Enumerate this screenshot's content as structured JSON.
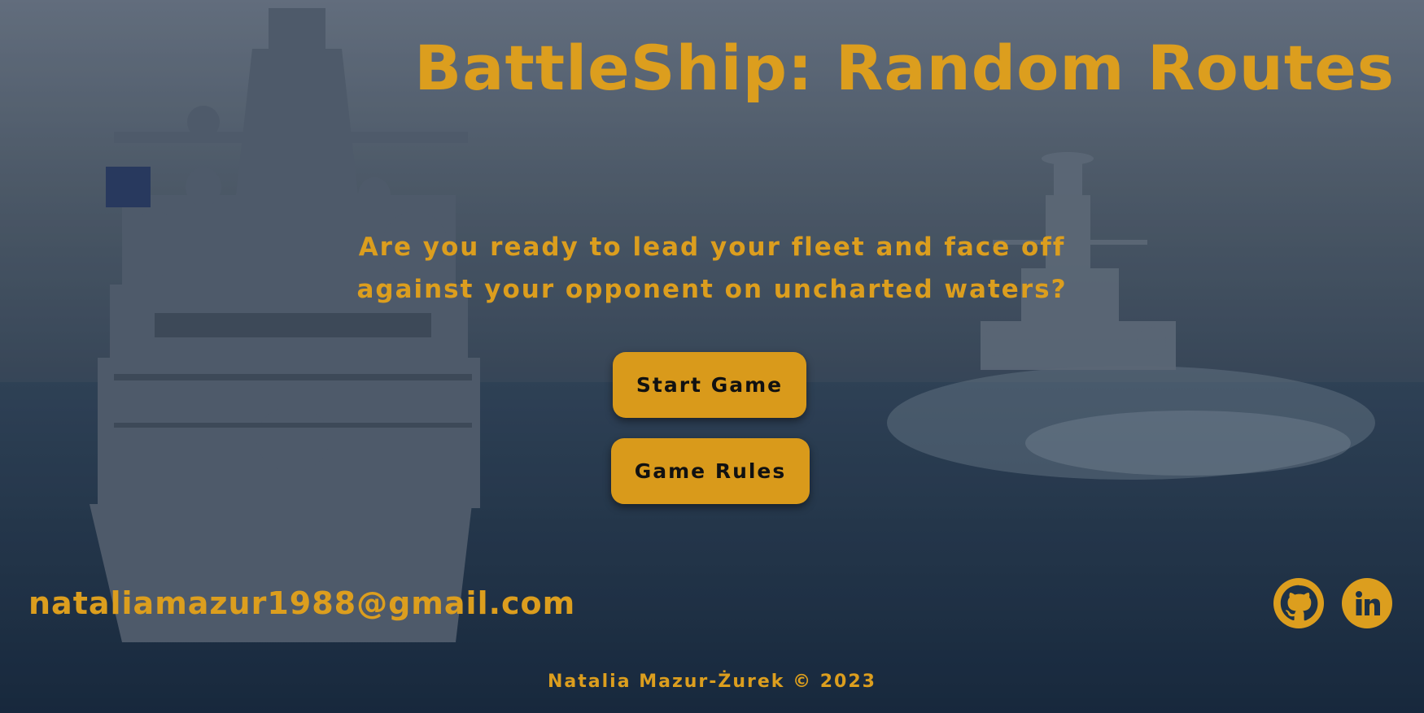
{
  "header": {
    "title": "BattleShip: Random Routes"
  },
  "hero": {
    "tagline_line1": "Are you ready to lead your fleet and face off",
    "tagline_line2": "against your opponent on uncharted waters?"
  },
  "buttons": {
    "start_label": "Start Game",
    "rules_label": "Game Rules"
  },
  "contact": {
    "email": "nataliamazur1988@gmail.com",
    "social": [
      {
        "name": "github",
        "icon": "github-icon"
      },
      {
        "name": "linkedin",
        "icon": "linkedin-icon"
      }
    ]
  },
  "footer": {
    "copyright": "Natalia Mazur-Żurek © 2023"
  },
  "colors": {
    "accent": "#dc9e1e",
    "button_bg": "#d99a1b",
    "button_text": "#111111",
    "background": "#22384f"
  }
}
